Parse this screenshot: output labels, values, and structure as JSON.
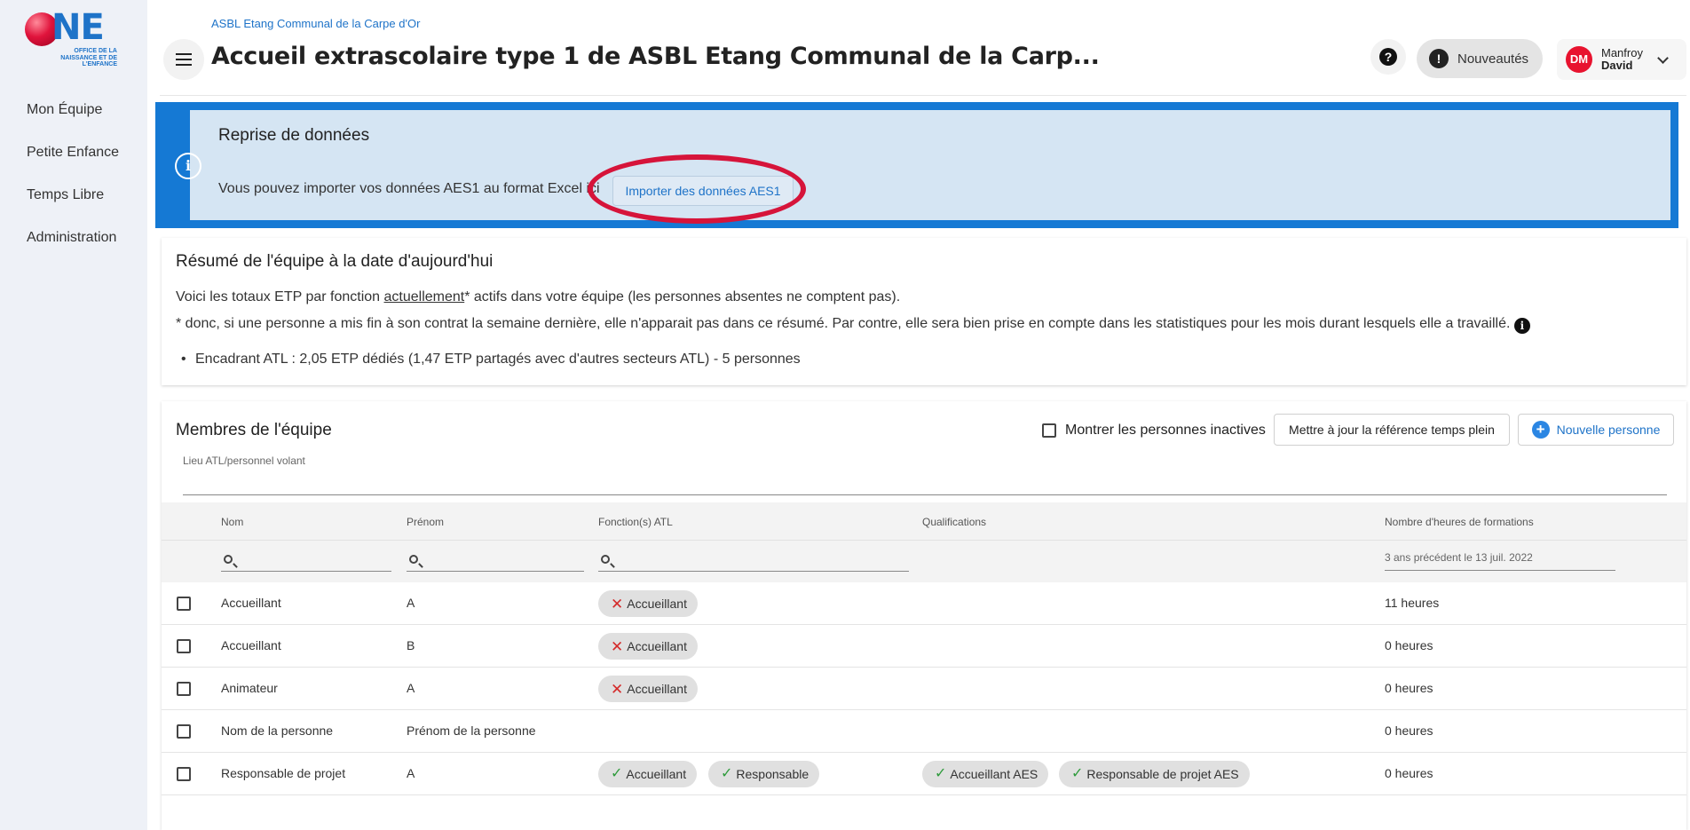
{
  "logo": {
    "text": "NE",
    "subtitle": "OFFICE DE LA NAISSANCE ET DE L'ENFANCE"
  },
  "sidebar": {
    "items": [
      {
        "label": "Mon Équipe"
      },
      {
        "label": "Petite Enfance"
      },
      {
        "label": "Temps Libre"
      },
      {
        "label": "Administration"
      }
    ]
  },
  "header": {
    "org": "ASBL Etang Communal de la Carpe d'Or",
    "title": "Accueil extrascolaire type 1 de ASBL Etang Communal de la Carp...",
    "help_icon": "?",
    "news_icon": "!",
    "news_label": "Nouveautés",
    "user": {
      "initials": "DM",
      "last_name": "Manfroy",
      "first_name": "David"
    }
  },
  "banner": {
    "icon": "i",
    "title": "Reprise de données",
    "text": "Vous pouvez importer vos données AES1 au format Excel ici",
    "button": "Importer des données AES1",
    "accent": "#1579d4",
    "background": "#d5e5f3",
    "annotation_color": "#d6143a"
  },
  "summary": {
    "title": "Résumé de l'équipe à la date d'aujourd'hui",
    "line1_before": "Voici les totaux ETP par fonction ",
    "line1_underlined": "actuellement",
    "line1_after": "* actifs dans votre équipe (les personnes absentes ne comptent pas).",
    "line2": "* donc, si une personne a mis fin à son contrat la semaine dernière, elle n'apparait pas dans ce résumé. Par contre, elle sera bien prise en compte dans les statistiques pour les mois durant lesquels elle a travaillé.",
    "info_icon": "i",
    "bullet": "Encadrant ATL : 2,05 ETP dédiés (1,47 ETP partagés avec d'autres secteurs ATL) - 5 personnes"
  },
  "team": {
    "title": "Membres de l'équipe",
    "show_inactive": "Montrer les personnes inactives",
    "update_button": "Mettre à jour la référence temps plein",
    "new_button": "Nouvelle personne",
    "new_icon": "+",
    "lieu_label": "Lieu ATL/personnel volant",
    "columns": {
      "nom": "Nom",
      "prenom": "Prénom",
      "fonctions": "Fonction(s) ATL",
      "qualifications": "Qualifications",
      "heures": "Nombre d'heures de formations"
    },
    "heures_filter_hint": "3 ans précédent le 13 juil. 2022",
    "rows": [
      {
        "nom": "Accueillant",
        "prenom": "A",
        "fonction": "Accueillant",
        "heures": "11 heures"
      },
      {
        "nom": "Accueillant",
        "prenom": "B",
        "fonction": "Accueillant",
        "heures": "0 heures"
      },
      {
        "nom": "Animateur",
        "prenom": "A",
        "fonction": "Accueillant",
        "heures": "0 heures"
      },
      {
        "nom": "Nom de la personne",
        "prenom": "Prénom de la personne",
        "heures": "0 heures"
      },
      {
        "nom": "Responsable de projet",
        "prenom": "A",
        "fonction": "Accueillant",
        "fonction2": "Responsable",
        "qualif1": "Accueillant AES",
        "qualif2": "Responsable de projet AES",
        "heures": "0 heures"
      }
    ]
  }
}
